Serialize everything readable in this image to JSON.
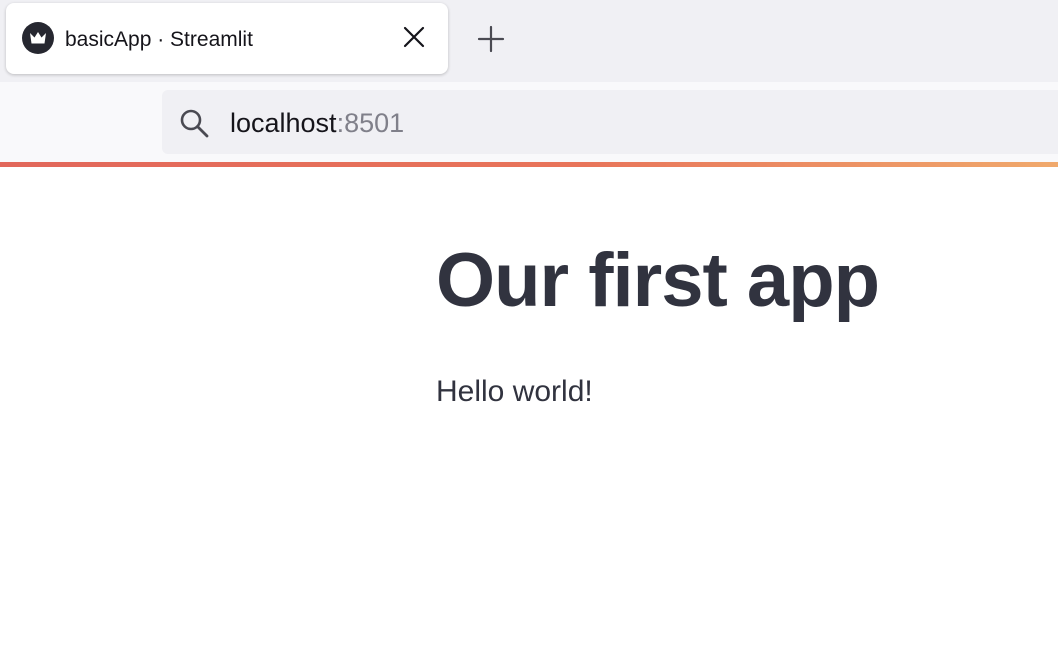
{
  "browser": {
    "tab": {
      "title": "basicApp · Streamlit",
      "favicon": "streamlit-crown-icon",
      "close_icon": "close-icon"
    },
    "new_tab_icon": "plus-icon",
    "address_bar": {
      "icon": "search-icon",
      "host": "localhost",
      "port": ":8501"
    },
    "accent_colors": [
      "#e2675b",
      "#f0a96c"
    ]
  },
  "app": {
    "title": "Our first app",
    "text": "Hello world!",
    "text_color": "#31333f"
  }
}
